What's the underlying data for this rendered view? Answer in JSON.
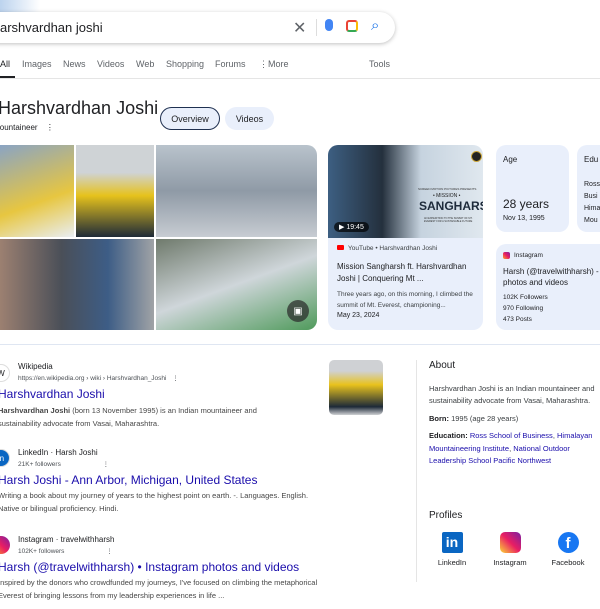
{
  "search": {
    "query": "arshvardhan joshi"
  },
  "tabs": [
    "All",
    "Images",
    "News",
    "Videos",
    "Web",
    "Shopping",
    "Forums",
    "More",
    "Tools"
  ],
  "entity": {
    "name": "Harshvardhan Joshi",
    "subtitle": "lountaineer",
    "pills": [
      "Overview",
      "Videos"
    ]
  },
  "video": {
    "duration": "19:45",
    "thumb_small": "SCREEN MOTION PICTURES PRESENTS",
    "thumb_mission": "• MISSION •",
    "thumb_title": "SANGHARSH",
    "thumb_sub": "AN EXPEDITION TO THE SUMMIT OF MT. EVEREST FOR A SUSTAINABLE FUTURE",
    "source": "YouTube • Harshvardhan Joshi",
    "title": "Mission Sangharsh ft. Harshvardhan Joshi | Conquering Mt ...",
    "snippet": "Three years ago, on this morning, I climbed the summit of Mt. Everest, championing...",
    "date": "May 23, 2024"
  },
  "age": {
    "label": "Age",
    "value": "28 years",
    "date": "Nov 13, 1995"
  },
  "education_card": {
    "label": "Edu",
    "lines": [
      "Ross",
      "Busi",
      "Hima",
      "Mou"
    ]
  },
  "instagram_card": {
    "source": "Instagram",
    "title": "Harsh (@travelwithharsh) - photos and videos",
    "stats": [
      "102K Followers",
      "970 Following",
      "473 Posts"
    ]
  },
  "results": [
    {
      "source": "Wikipedia",
      "url": "https://en.wikipedia.org › wiki › Harshvardhan_Joshi",
      "title": "Harshvardhan Joshi",
      "snippet_bold": "Harshvardhan Joshi",
      "snippet": " (born 13 November 1995) is an Indian mountaineer and",
      "snippet2": "sustainability advocate from Vasai, Maharashtra.",
      "favicon": "W"
    },
    {
      "source": "LinkedIn · Harsh Joshi",
      "url": "21K+ followers",
      "title": "Harsh Joshi - Ann Arbor, Michigan, United States",
      "snippet": "Writing a book about my journey of years to the highest point on earth. -. Languages. English.",
      "snippet2": "Native or bilingual proficiency. Hindi.",
      "favicon": "in"
    },
    {
      "source": "Instagram · travelwithharsh",
      "url": "102K+ followers",
      "title": "Harsh (@travelwithharsh) • Instagram photos and videos",
      "snippet": "Inspired by the donors who crowdfunded my journeys, I've focused on climbing the metaphorical",
      "snippet2": "Everest of bringing lessons from my leadership experiences in life ...",
      "favicon": "ig"
    }
  ],
  "about": {
    "heading": "About",
    "text1": "Harshvardhan Joshi is an Indian mountaineer and",
    "text2": "sustainability advocate from Vasai, Maharashtra.",
    "born_label": "Born:",
    "born": " 1995 (age 28 years)",
    "edu_label": "Education:",
    "edu_links": [
      "Ross School of Business",
      "Himalayan Mountaineering Institute",
      "National Outdoor Leadership School Pacific Northwest"
    ]
  },
  "profiles": {
    "heading": "Profiles",
    "items": [
      "LinkedIn",
      "Instagram",
      "Facebook"
    ]
  },
  "colors": {
    "link": "#1a0dab",
    "card_bg": "#e9effb",
    "accent": "#1a73e8"
  }
}
